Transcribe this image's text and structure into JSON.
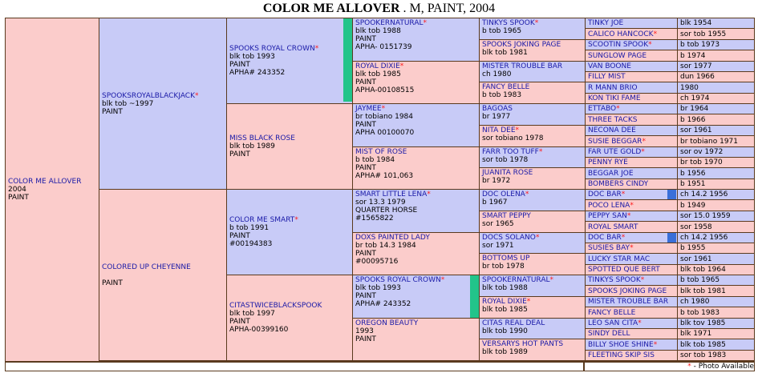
{
  "title": {
    "name": "COLOR ME ALLOVER",
    "details": " . M, PAINT, 2004"
  },
  "subject": {
    "name": "COLOR ME ALLOVER",
    "lines": [
      "2004",
      "PAINT"
    ],
    "photo": false
  },
  "gen1": [
    {
      "name": "SPOOKSROYALBLACKJACK",
      "photo": true,
      "lines": [
        "blk tob ~1997",
        "PAINT"
      ]
    },
    {
      "name": "COLORED UP CHEYENNE",
      "photo": false,
      "lines": [
        "",
        "PAINT"
      ]
    }
  ],
  "gen2": [
    {
      "name": "SPOOKS ROYAL CROWN",
      "photo": true,
      "lines": [
        "blk tob 1993",
        "PAINT",
        "APHA# 243352"
      ]
    },
    {
      "name": "MISS BLACK ROSE",
      "photo": false,
      "lines": [
        "blk tob 1989",
        "PAINT"
      ]
    },
    {
      "name": "COLOR ME SMART",
      "photo": true,
      "lines": [
        "b tob 1991",
        "PAINT",
        "#00194383"
      ]
    },
    {
      "name": "CITASTWICEBLACKSPOOK",
      "photo": false,
      "lines": [
        "blk tob 1997",
        "PAINT",
        "APHA-00399160"
      ]
    }
  ],
  "gen3": [
    {
      "name": "SPOOKERNATURAL",
      "photo": true,
      "lines": [
        "blk tob 1988",
        "PAINT",
        "APHA- 0151739"
      ]
    },
    {
      "name": "ROYAL DIXIE",
      "photo": true,
      "lines": [
        "blk tob 1985",
        "PAINT",
        "APHA-00108515"
      ]
    },
    {
      "name": "JAYMEE",
      "photo": true,
      "lines": [
        "br tobiano 1984",
        "PAINT",
        "APHA 00100070"
      ]
    },
    {
      "name": "MIST OF ROSE",
      "photo": false,
      "lines": [
        "b tob 1984",
        "PAINT",
        "APHA# 101,063"
      ]
    },
    {
      "name": "SMART LITTLE LENA",
      "photo": true,
      "lines": [
        "sor 13.3 1979",
        "QUARTER HORSE",
        "#1565822"
      ]
    },
    {
      "name": "DOXS PAINTED LADY",
      "photo": false,
      "lines": [
        "br tob 14.3 1984",
        "PAINT",
        "#00095716"
      ]
    },
    {
      "name": "SPOOKS ROYAL CROWN",
      "photo": true,
      "lines": [
        "blk tob 1993",
        "PAINT",
        "APHA# 243352"
      ]
    },
    {
      "name": "OREGON BEAUTY",
      "photo": false,
      "lines": [
        "1993",
        "PAINT"
      ]
    }
  ],
  "gen4": [
    {
      "name": "TINKYS SPOOK",
      "photo": true,
      "lines": [
        "b tob 1965"
      ]
    },
    {
      "name": "SPOOKS JOKING PAGE",
      "photo": false,
      "lines": [
        "blk tob 1981"
      ]
    },
    {
      "name": "MISTER TROUBLE BAR",
      "photo": false,
      "lines": [
        "ch 1980"
      ]
    },
    {
      "name": "FANCY BELLE",
      "photo": false,
      "lines": [
        "b tob 1983"
      ]
    },
    {
      "name": "BAGOAS",
      "photo": false,
      "lines": [
        "br 1977"
      ]
    },
    {
      "name": "NITA DEE",
      "photo": true,
      "lines": [
        "sor tobiano 1978"
      ]
    },
    {
      "name": "FARR TOO TUFF",
      "photo": true,
      "lines": [
        "sor tob 1978"
      ]
    },
    {
      "name": "JUANITA ROSE",
      "photo": false,
      "lines": [
        "br 1972"
      ]
    },
    {
      "name": "DOC OLENA",
      "photo": true,
      "lines": [
        "b 1967"
      ]
    },
    {
      "name": "SMART PEPPY",
      "photo": false,
      "lines": [
        "sor 1965"
      ]
    },
    {
      "name": "DOCS SOLANO",
      "photo": true,
      "lines": [
        "sor 1971"
      ]
    },
    {
      "name": "BOTTOMS UP",
      "photo": false,
      "lines": [
        "br tob 1978"
      ]
    },
    {
      "name": "SPOOKERNATURAL",
      "photo": true,
      "lines": [
        "blk tob 1988"
      ]
    },
    {
      "name": "ROYAL DIXIE",
      "photo": true,
      "lines": [
        "blk tob 1985"
      ]
    },
    {
      "name": "CITAS REAL DEAL",
      "photo": false,
      "lines": [
        "blk tob 1990"
      ]
    },
    {
      "name": "VERSARYS HOT PANTS",
      "photo": false,
      "lines": [
        "blk tob 1989"
      ]
    }
  ],
  "gen5": [
    {
      "name": "TINKY JOE",
      "photo": false,
      "info": "blk 1954"
    },
    {
      "name": "CALICO HANCOCK",
      "photo": true,
      "info": "sor tob 1955"
    },
    {
      "name": "SCOOTIN SPOOK",
      "photo": true,
      "info": "b tob 1973"
    },
    {
      "name": "SUNGLOW PAGE",
      "photo": false,
      "info": "b 1974"
    },
    {
      "name": "VAN BOONE",
      "photo": false,
      "info": "sor 1977"
    },
    {
      "name": "FILLY MIST",
      "photo": false,
      "info": "dun 1966"
    },
    {
      "name": "R MANN BRIO",
      "photo": false,
      "info": "1980"
    },
    {
      "name": "KON TIKI FAME",
      "photo": false,
      "info": "ch 1974"
    },
    {
      "name": "ETTABO",
      "photo": true,
      "info": "br 1964"
    },
    {
      "name": "THREE TACKS",
      "photo": false,
      "info": "b 1966"
    },
    {
      "name": "NECONA DEE",
      "photo": false,
      "info": "sor 1961"
    },
    {
      "name": "SUSIE BEGGAR",
      "photo": true,
      "info": "br tobiano 1971"
    },
    {
      "name": "FAR UTE GOLD",
      "photo": true,
      "info": "sor ov 1972"
    },
    {
      "name": "PENNY RYE",
      "photo": false,
      "info": "br tob 1970"
    },
    {
      "name": "BEGGAR JOE",
      "photo": false,
      "info": "b 1956"
    },
    {
      "name": "BOMBERS CINDY",
      "photo": false,
      "info": "b 1951"
    },
    {
      "name": "DOC BAR",
      "photo": true,
      "info": "ch 14.2 1956"
    },
    {
      "name": "POCO LENA",
      "photo": true,
      "info": "b 1949"
    },
    {
      "name": "PEPPY SAN",
      "photo": true,
      "info": "sor 15.0 1959"
    },
    {
      "name": "ROYAL SMART",
      "photo": false,
      "info": "sor 1958"
    },
    {
      "name": "DOC BAR",
      "photo": true,
      "info": "ch 14.2 1956"
    },
    {
      "name": "SUSIES BAY",
      "photo": true,
      "info": "b 1955"
    },
    {
      "name": "LUCKY STAR MAC",
      "photo": false,
      "info": "sor 1961"
    },
    {
      "name": "SPOTTED QUE BERT",
      "photo": false,
      "info": "blk tob 1964"
    },
    {
      "name": "TINKYS SPOOK",
      "photo": true,
      "info": "b tob 1965"
    },
    {
      "name": "SPOOKS JOKING PAGE",
      "photo": false,
      "info": "blk tob 1981"
    },
    {
      "name": "MISTER TROUBLE BAR",
      "photo": false,
      "info": "ch 1980"
    },
    {
      "name": "FANCY BELLE",
      "photo": false,
      "info": "b tob 1983"
    },
    {
      "name": "LEO SAN CITA",
      "photo": true,
      "info": "blk tov 1985"
    },
    {
      "name": "SINDY DELL",
      "photo": false,
      "info": "blk 1971"
    },
    {
      "name": "BILLY SHOE SHINE",
      "photo": true,
      "info": "blk tob 1985"
    },
    {
      "name": "FLEETING SKIP SIS",
      "photo": false,
      "info": "sor tob 1983"
    }
  ],
  "photo_marker": "*",
  "legend": {
    "marker": "*",
    "text": " - Photo Available"
  },
  "colors": {
    "sire": "#c8cbf7",
    "dam": "#fbcccb",
    "name_link": "#1a1aa8",
    "photo_marker": "#ff1a1a",
    "border": "#5a3a1e",
    "green_bar": "#22c48a",
    "blue_box": "#3a6fd8"
  }
}
